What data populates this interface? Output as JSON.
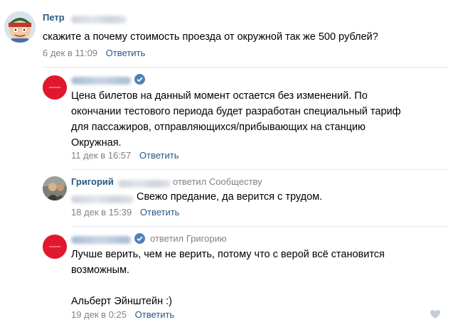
{
  "comments": [
    {
      "author": "Петр",
      "text": "скажите а почему стоимость проезда от окружной так же 500 рублей?",
      "date": "6 дек в 11:09",
      "reply_label": "Ответить"
    },
    {
      "text_lines": [
        "Цена билетов на данный момент остается без изменений. По",
        "окончании тестового периода будет разработан специальный тариф",
        "для пассажиров, отправляющихся/прибывающих на станцию",
        "Окружная."
      ],
      "date": "11 дек в 16:57",
      "reply_label": "Ответить"
    },
    {
      "author": "Григорий",
      "reply_to": "ответил Сообществу",
      "text": "Свежо предание, да верится с трудом.",
      "date": "18 дек в 15:39",
      "reply_label": "Ответить"
    },
    {
      "reply_to": "ответил Григорию",
      "text_lines": [
        "Лучше верить, чем не верить, потому что с верой всё становится",
        "возможным.",
        "",
        "Альберт Эйнштейн :)"
      ],
      "date": "19 дек в 0:25",
      "reply_label": "Ответить"
    }
  ],
  "icons": {
    "verified": "verified-checkmark-icon",
    "like": "heart-icon"
  },
  "colors": {
    "link": "#2a5885",
    "muted": "#828282",
    "community_avatar": "#e0182d",
    "verified": "#5181b8"
  }
}
